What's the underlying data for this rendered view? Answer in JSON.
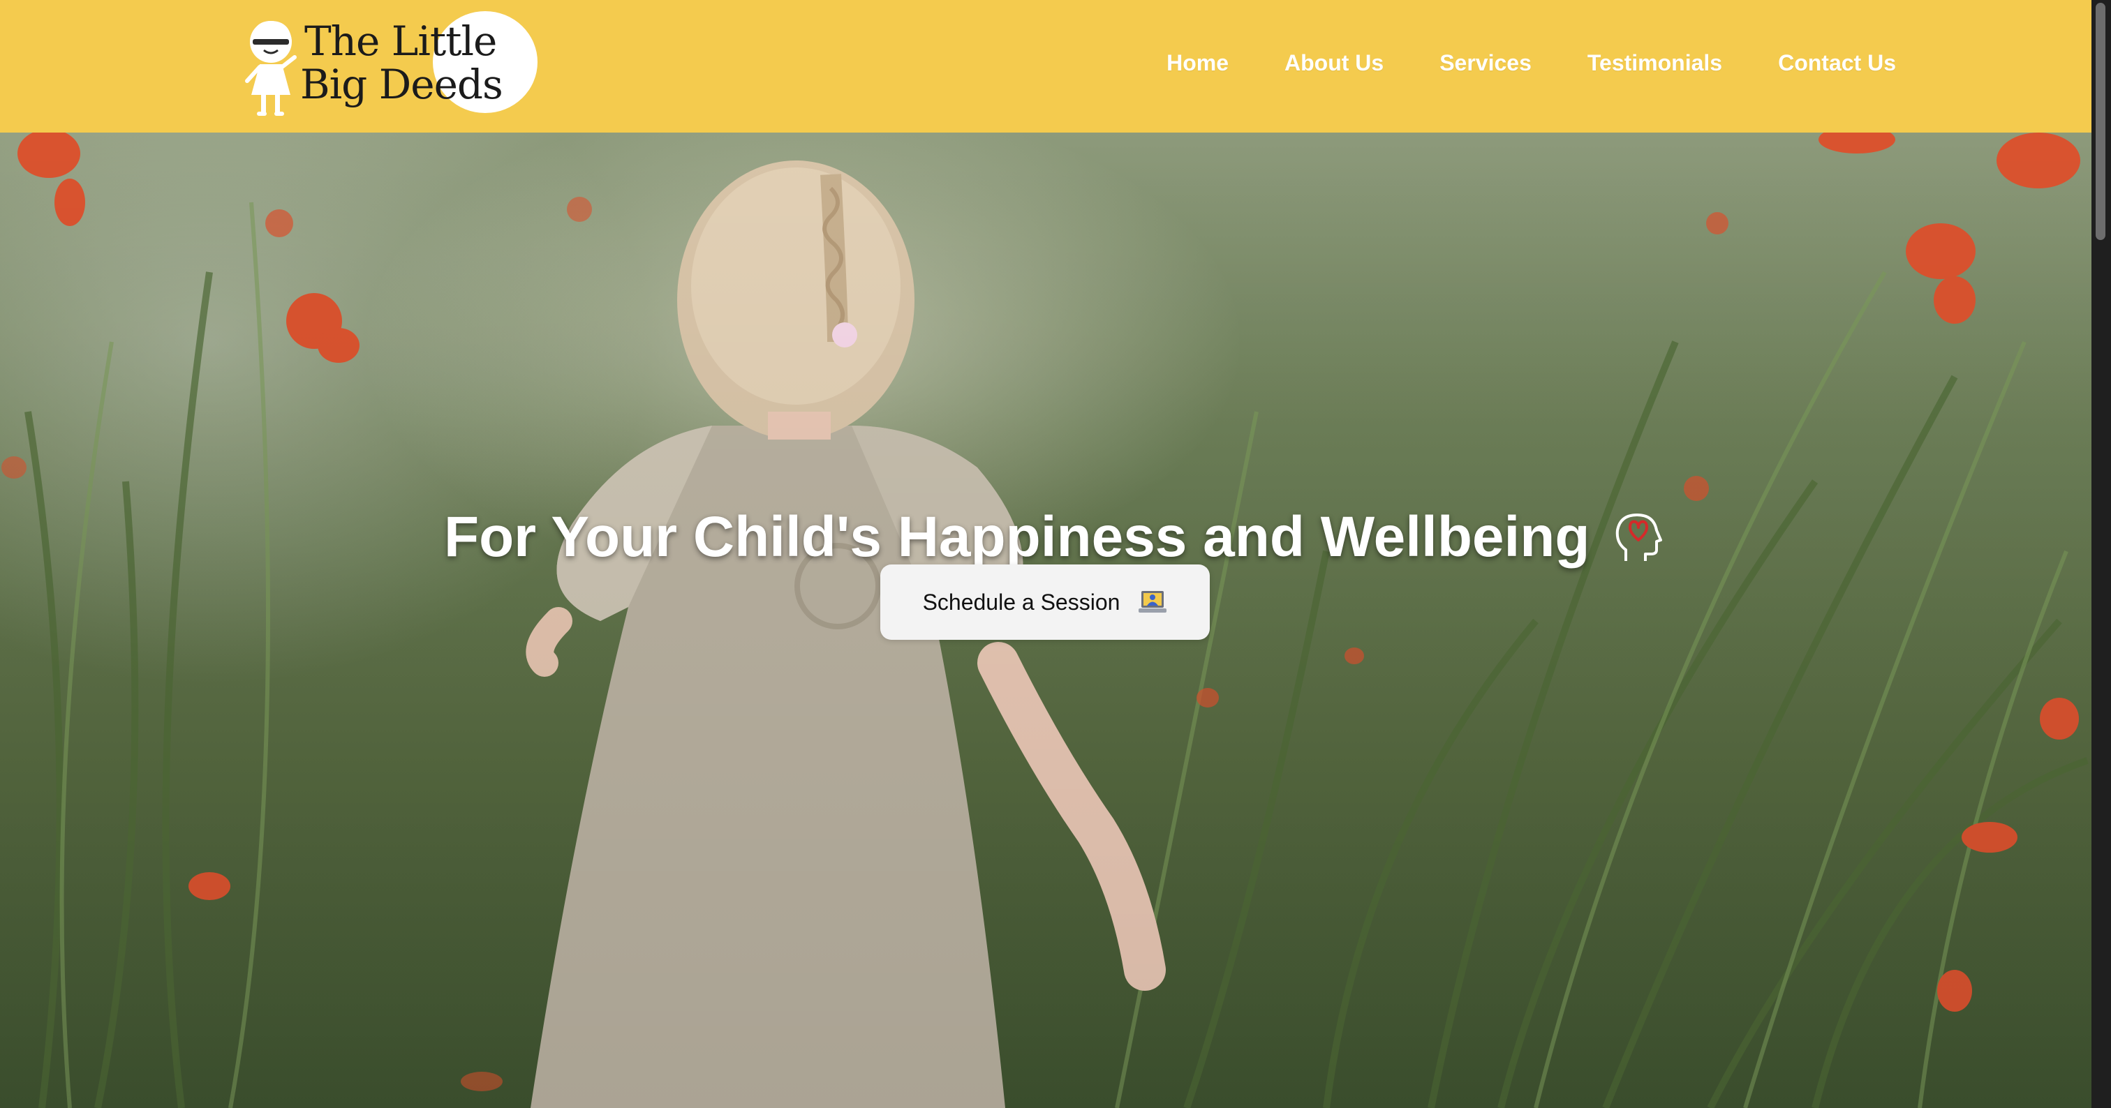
{
  "brand": {
    "line1": "The Little",
    "line2": "Big Deeds"
  },
  "nav": {
    "items": [
      {
        "label": "Home"
      },
      {
        "label": "About Us"
      },
      {
        "label": "Services"
      },
      {
        "label": "Testimonials"
      },
      {
        "label": "Contact Us"
      }
    ]
  },
  "hero": {
    "title": "For Your Child's Happiness and Wellbeing",
    "title_icon": "head-heart-icon",
    "cta_label": "Schedule a Session",
    "cta_icon": "laptop-icon"
  },
  "colors": {
    "header_bg": "#f4cb4e",
    "nav_text": "#ffffff",
    "cta_bg": "#f3f3f3",
    "poppy": "#d9532f"
  }
}
